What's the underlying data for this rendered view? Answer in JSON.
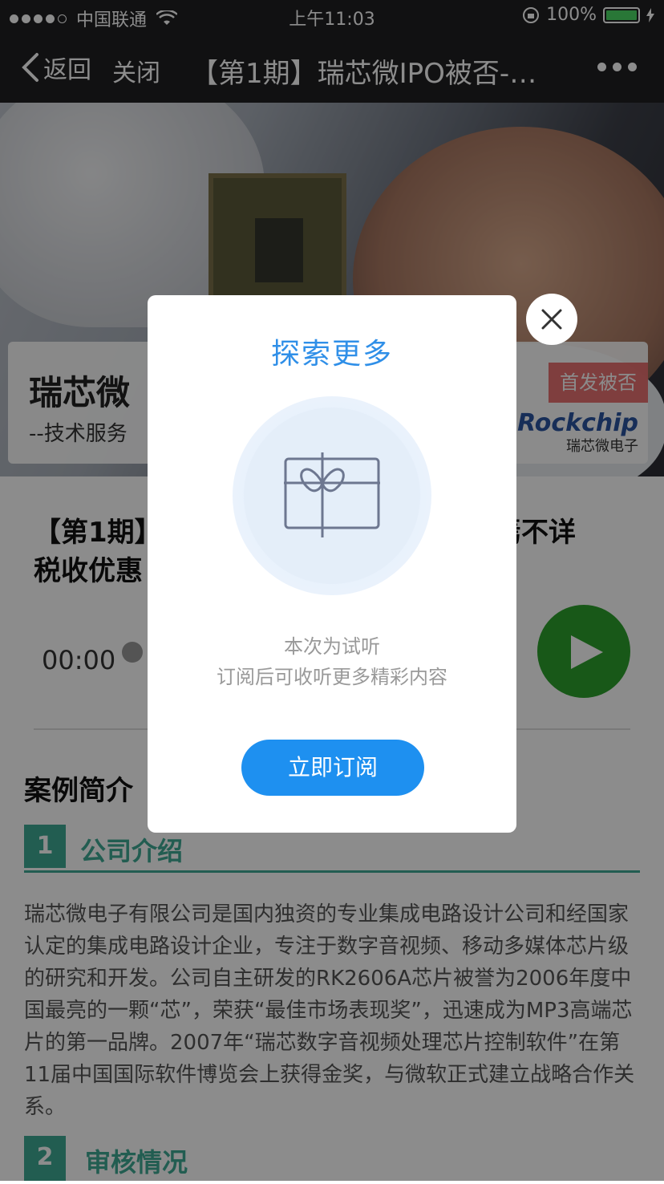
{
  "status_bar": {
    "carrier": "中国联通",
    "time": "上午11:03",
    "battery": "100%"
  },
  "nav": {
    "back_label": "返回",
    "close_label": "关闭",
    "title": "【第1期】瑞芯微IPO被否-…"
  },
  "hero": {
    "company": "瑞芯微",
    "slogan": "--技术服务",
    "badge": "首发被否",
    "brand_logo": "Rockchip",
    "brand_sub": "瑞芯微电子"
  },
  "article": {
    "title_line1": "【第1期】",
    "title_line1_tail": "焉不详",
    "title_line2": "税收优惠",
    "time": "00:00"
  },
  "sections": {
    "intro_title": "案例简介",
    "items": [
      {
        "num": "1",
        "label": "公司介绍"
      },
      {
        "num": "2",
        "label": "审核情况"
      }
    ],
    "company_intro": "瑞芯微电子有限公司是国内独资的专业集成电路设计公司和经国家认定的集成电路设计企业，专注于数字音视频、移动多媒体芯片级的研究和开发。公司自主研发的RK2606A芯片被誉为2006年度中国最亮的一颗“芯”，荣获“最佳市场表现奖”，迅速成为MP3高端芯片的第一品牌。2007年“瑞芯数字音视频处理芯片控制软件”在第11届中国国际软件博览会上获得金奖，与微软正式建立战略合作关系。"
  },
  "modal": {
    "title": "探索更多",
    "line1": "本次为试听",
    "line2": "订阅后可收听更多精彩内容",
    "button": "立即订阅"
  },
  "colors": {
    "accent_blue": "#1e90f0",
    "section_green": "#3fa994",
    "play_green": "#2ca02c"
  }
}
